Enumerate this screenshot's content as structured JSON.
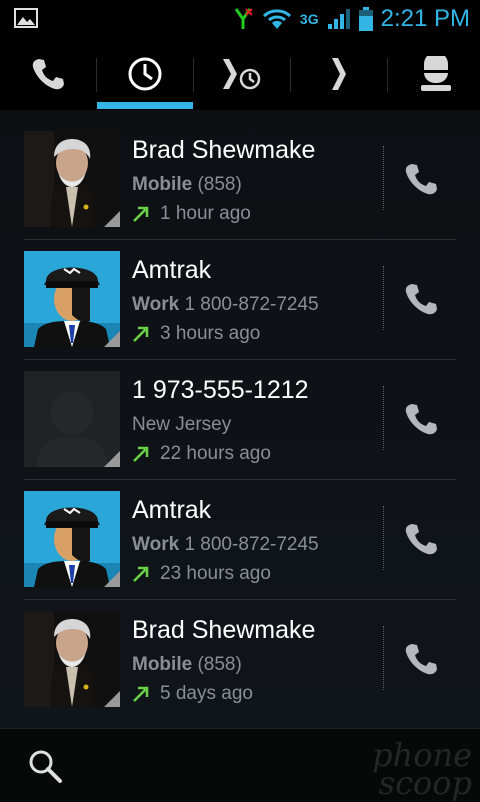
{
  "status_bar": {
    "network": "3G",
    "time": "2:21 PM",
    "accent_color": "#33b5e5"
  },
  "tabs": [
    {
      "id": "dialer",
      "icon": "phone-icon"
    },
    {
      "id": "call-log",
      "icon": "clock-icon",
      "selected": true
    },
    {
      "id": "recent-contacts",
      "icon": "clock-chevron-icon"
    },
    {
      "id": "favorites",
      "icon": "chevron-icon"
    },
    {
      "id": "contacts",
      "icon": "person-icon"
    }
  ],
  "calls": [
    {
      "name": "Brad Shewmake",
      "type": "Mobile",
      "number": "(858)",
      "time": "1 hour ago",
      "avatar": "photo-man"
    },
    {
      "name": "Amtrak",
      "type": "Work",
      "number": "1 800-872-7245",
      "time": "3 hours ago",
      "avatar": "amtrak-conductor"
    },
    {
      "name": "1 973-555-1212",
      "type": "",
      "number": "New Jersey",
      "time": "22 hours ago",
      "avatar": "placeholder"
    },
    {
      "name": "Amtrak",
      "type": "Work",
      "number": "1 800-872-7245",
      "time": "23 hours ago",
      "avatar": "amtrak-conductor"
    },
    {
      "name": "Brad Shewmake",
      "type": "Mobile",
      "number": "(858)",
      "time": "5 days ago",
      "avatar": "photo-man"
    }
  ],
  "watermark": {
    "line1": "phone",
    "line2": "scoop"
  }
}
